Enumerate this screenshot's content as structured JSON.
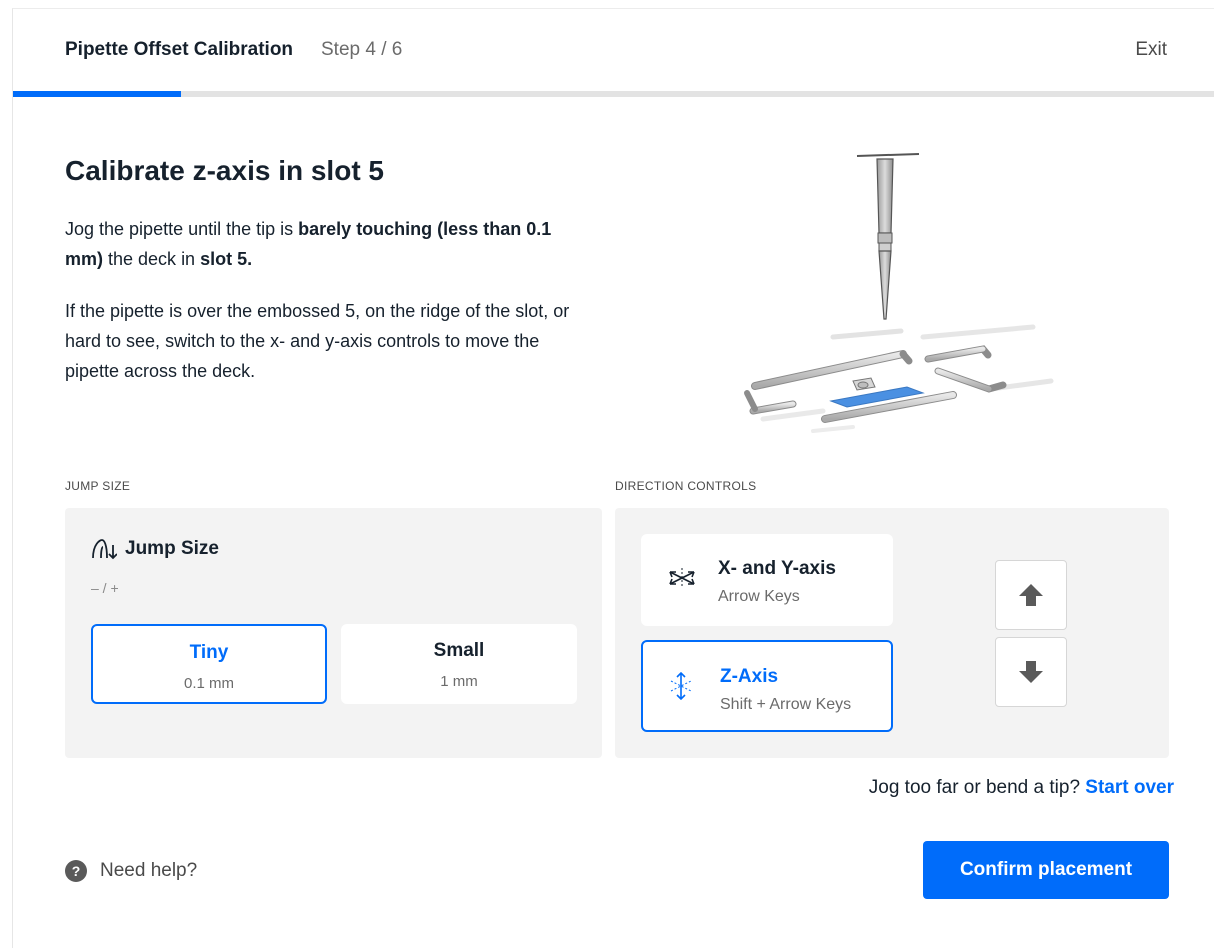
{
  "header": {
    "title": "Pipette Offset Calibration",
    "step": "Step 4 / 6",
    "exit_label": "Exit",
    "progress": 0.14
  },
  "content": {
    "heading": "Calibrate z-axis in slot 5",
    "p1": {
      "t1": "Jog the pipette until the tip is ",
      "b1": "barely touching (less than 0.1 mm)",
      "t2": " the deck in ",
      "b2": "slot 5."
    },
    "p2": "If the pipette is over the embossed 5, on the ridge of the slot, or hard to see, switch to the x- and y-axis controls to move the pipette across the deck."
  },
  "jump": {
    "section_label": "JUMP SIZE",
    "title": "Jump Size",
    "shortcut": "– / +",
    "options": [
      {
        "name": "Tiny",
        "value": "0.1 mm",
        "selected": true
      },
      {
        "name": "Small",
        "value": "1 mm",
        "selected": false
      }
    ]
  },
  "direction": {
    "section_label": "DIRECTION CONTROLS",
    "modes": [
      {
        "name": "X- and Y-axis",
        "keys": "Arrow Keys",
        "selected": false
      },
      {
        "name": "Z-Axis",
        "keys": "Shift + Arrow Keys",
        "selected": true
      }
    ]
  },
  "start_over": {
    "prompt": "Jog too far or bend a tip?",
    "link": "Start over"
  },
  "footer": {
    "help_icon_glyph": "?",
    "help_label": "Need help?",
    "confirm_label": "Confirm placement"
  },
  "colors": {
    "accent": "#006cfa",
    "text": "#16212d",
    "panel": "#f3f3f3"
  }
}
